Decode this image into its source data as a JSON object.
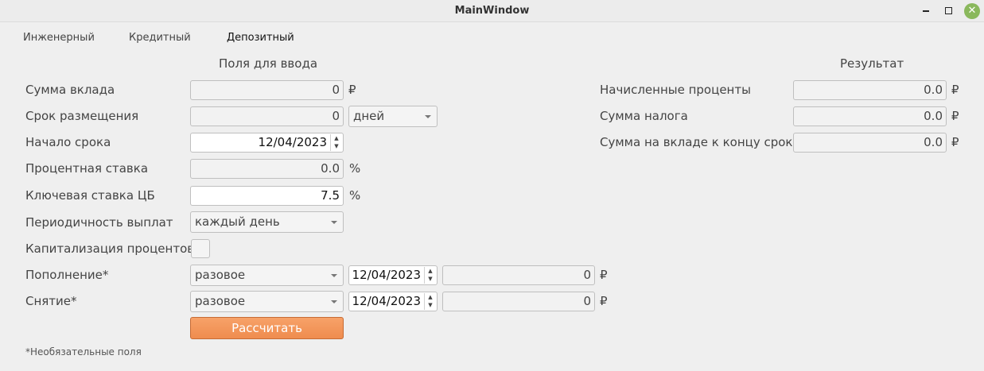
{
  "window": {
    "title": "MainWindow"
  },
  "tabs": [
    "Инженерный",
    "Кредитный",
    "Депозитный"
  ],
  "input_section": {
    "title": "Поля для ввода",
    "deposit_amount": {
      "label": "Сумма вклада",
      "value": "0",
      "unit": "₽"
    },
    "term": {
      "label": "Срок размещения",
      "value": "0",
      "unit_selected": "дней"
    },
    "start_date": {
      "label": "Начало срока",
      "value": "12/04/2023"
    },
    "interest_rate": {
      "label": "Процентная ставка",
      "value": "0.0",
      "unit": "%"
    },
    "key_rate": {
      "label": "Ключевая ставка ЦБ",
      "value": "7.5",
      "unit": "%"
    },
    "payment_frequency": {
      "label": "Периодичность выплат",
      "selected": "каждый день"
    },
    "capitalization": {
      "label": "Капитализация процентов",
      "checked": false
    },
    "replenishment": {
      "label": "Пополнение*",
      "type_selected": "разовое",
      "date": "12/04/2023",
      "amount": "0",
      "unit": "₽"
    },
    "withdrawal": {
      "label": "Снятие*",
      "type_selected": "разовое",
      "date": "12/04/2023",
      "amount": "0",
      "unit": "₽"
    },
    "calculate_label": "Рассчитать",
    "footnote": "*Необязательные поля"
  },
  "result_section": {
    "title": "Результат",
    "accrued_interest": {
      "label": "Начисленные проценты",
      "value": "0.0",
      "unit": "₽"
    },
    "tax_amount": {
      "label": "Сумма налога",
      "value": "0.0",
      "unit": "₽"
    },
    "final_amount": {
      "label": "Сумма на вкладе к концу срока",
      "value": "0.0",
      "unit": "₽"
    }
  },
  "colors": {
    "accent": "#ef8c4f",
    "close_button": "#8ab85c",
    "background": "#efefef"
  }
}
